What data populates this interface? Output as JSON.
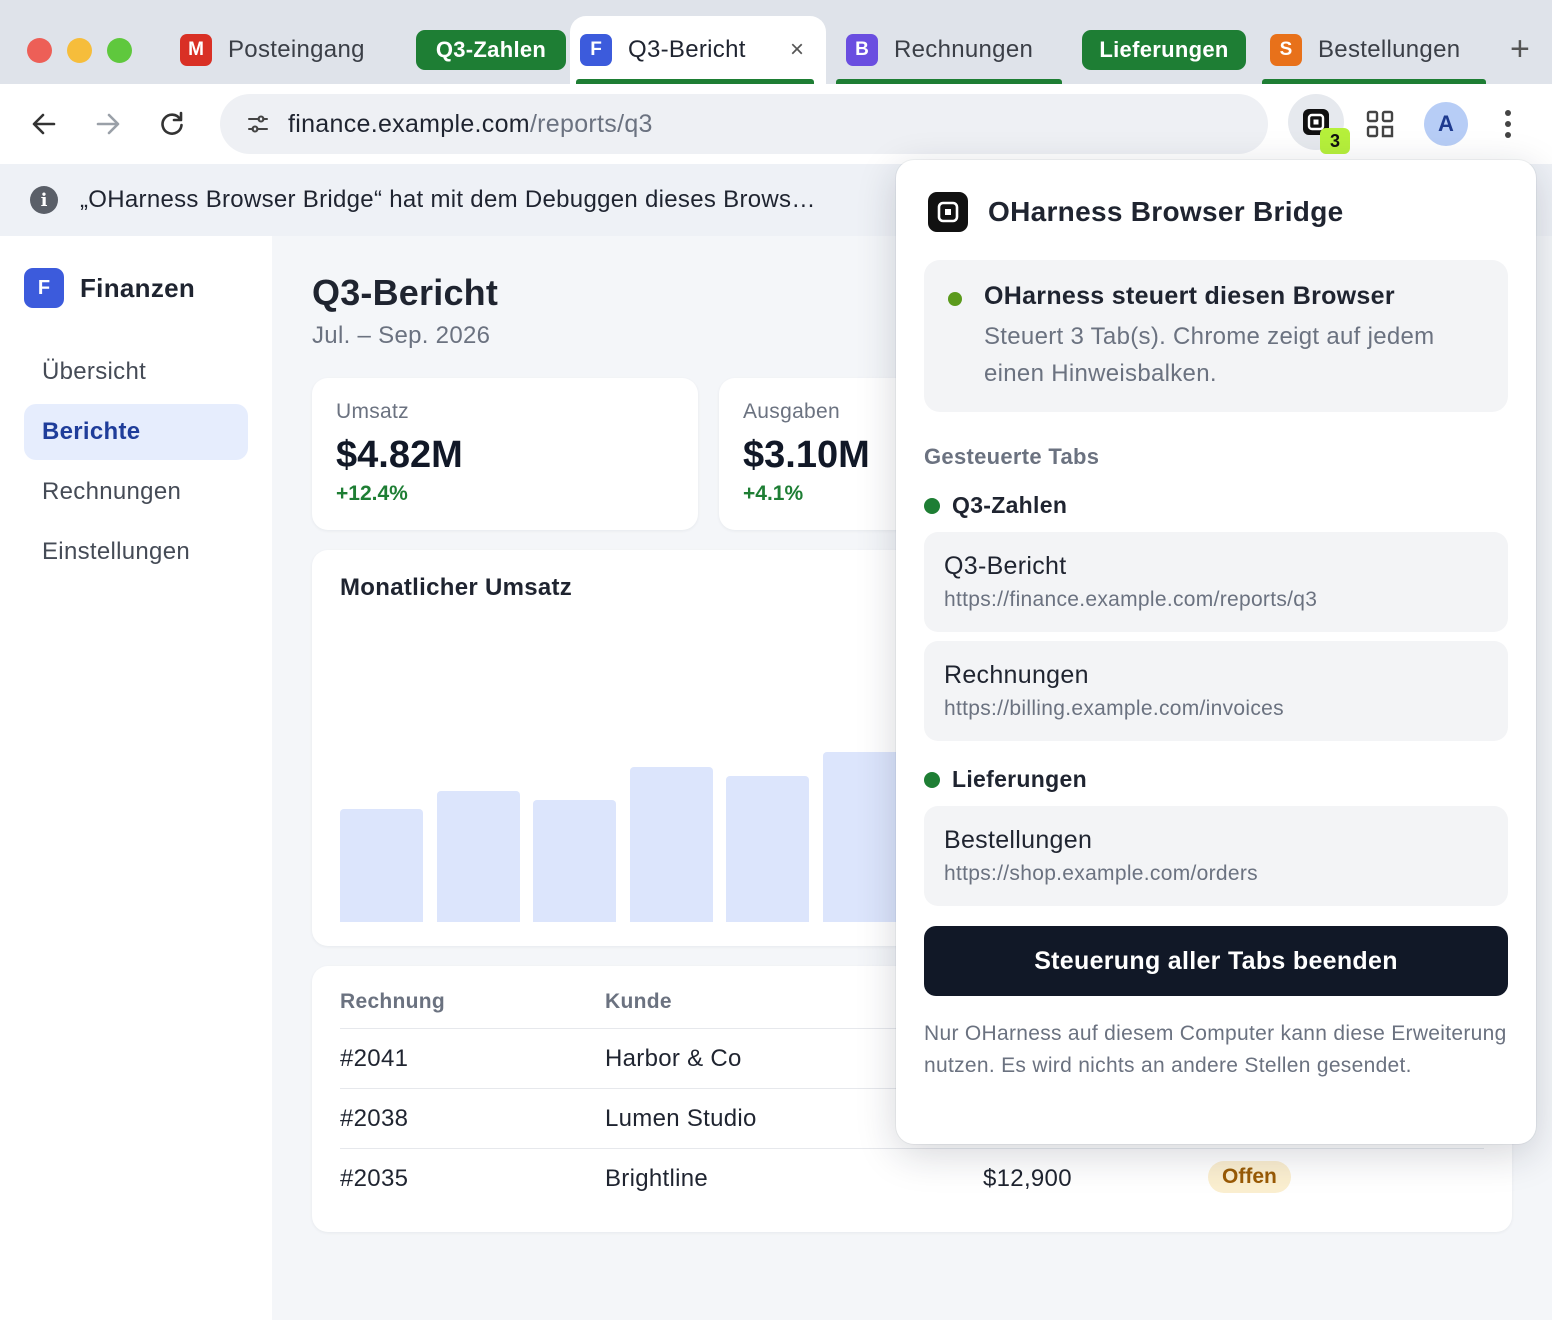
{
  "tabs": [
    {
      "favicon_letter": "M",
      "favicon_color": "#d93025",
      "label": "Posteingang"
    },
    {
      "favicon_letter": "F",
      "favicon_color": "#3c5bdc",
      "label": "Q3-Bericht",
      "close": "×"
    },
    {
      "favicon_letter": "B",
      "favicon_color": "#6a4ee0",
      "label": "Rechnungen"
    },
    {
      "favicon_letter": "S",
      "favicon_color": "#e8711a",
      "label": "Bestellungen"
    }
  ],
  "tab_groups": {
    "group1": "Q3-Zahlen",
    "group2": "Lieferungen",
    "color": "#1e7e34"
  },
  "new_tab": "+",
  "address": {
    "host": "finance.example.com",
    "path": "/reports/q3"
  },
  "extension": {
    "badge": "3"
  },
  "profile": {
    "initial": "A"
  },
  "infobar": {
    "icon": "i",
    "text": "„OHarness Browser Bridge“ hat mit dem Debuggen dieses Brows…"
  },
  "sidebar": {
    "brand_letter": "F",
    "brand_name": "Finanzen",
    "items": [
      {
        "label": "Übersicht"
      },
      {
        "label": "Berichte"
      },
      {
        "label": "Rechnungen"
      },
      {
        "label": "Einstellungen"
      }
    ]
  },
  "main": {
    "title": "Q3-Bericht",
    "subtitle": "Jul. – Sep. 2026",
    "kpis": [
      {
        "label": "Umsatz",
        "value": "$4.82M",
        "delta": "+12.4%"
      },
      {
        "label": "Ausgaben",
        "value": "$3.10M",
        "delta": "+4.1%"
      }
    ]
  },
  "chart_data": {
    "type": "bar",
    "title": "Monatlicher Umsatz",
    "xlabel": "",
    "ylabel": "",
    "grid": false,
    "values": [
      113,
      131,
      122,
      155,
      146,
      170
    ],
    "color": "#dce5fc"
  },
  "table": {
    "headers": [
      "Rechnung",
      "Kunde"
    ],
    "rows": [
      {
        "id": "#2041",
        "customer": "Harbor & Co",
        "amount": "",
        "status": ""
      },
      {
        "id": "#2038",
        "customer": "Lumen Studio",
        "amount": "",
        "status": ""
      },
      {
        "id": "#2035",
        "customer": "Brightline",
        "amount": "$12,900",
        "status": "Offen"
      }
    ]
  },
  "popup": {
    "title": "OHarness Browser Bridge",
    "status_title": "OHarness steuert diesen Browser",
    "status_body": "Steuert 3 Tab(s). Chrome zeigt auf jedem einen Hinweisbalken.",
    "section_label": "Gesteuerte Tabs",
    "groups": [
      {
        "name": "Q3-Zahlen",
        "tabs": [
          {
            "title": "Q3-Bericht",
            "url": "https://finance.example.com/reports/q3"
          },
          {
            "title": "Rechnungen",
            "url": "https://billing.example.com/invoices"
          }
        ]
      },
      {
        "name": "Lieferungen",
        "tabs": [
          {
            "title": "Bestellungen",
            "url": "https://shop.example.com/orders"
          }
        ]
      }
    ],
    "stop_button": "Steuerung aller Tabs beenden",
    "footer": "Nur OHarness auf diesem Computer kann diese Erweiterung nutzen. Es wird nichts an andere Stellen gesendet."
  }
}
